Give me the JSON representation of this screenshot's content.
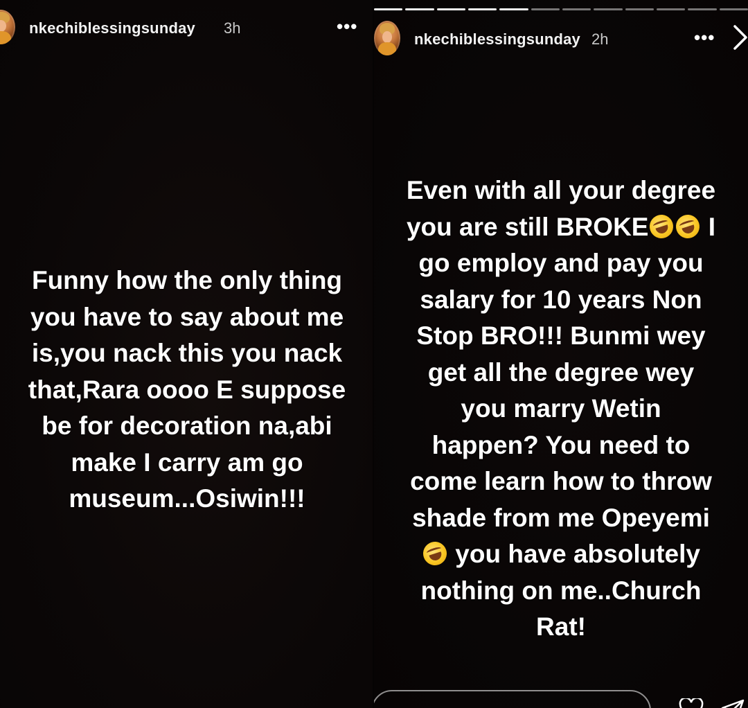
{
  "left_story": {
    "username": "nkechiblessingsunday",
    "time": "3h",
    "more_icon": "more-horizontal-icon",
    "lines": [
      "Funny how the only thing",
      "you have to say about me",
      "is,you nack this you nack",
      "that,Rara oooo E suppose",
      "be for decoration na,abi",
      "make I carry am go",
      "museum...Osiwin!!!"
    ]
  },
  "right_story": {
    "username": "nkechiblessingsunday",
    "time": "2h",
    "more_icon": "more-horizontal-icon",
    "next_icon": "chevron-right-icon",
    "progress": {
      "segments": 12,
      "completed": 5
    },
    "lines": {
      "l1": "Even with all your degree",
      "l2a": "you are still BROKE",
      "l2b": " I",
      "l3": "go employ and pay you",
      "l4": "salary for 10 years Non",
      "l5": "Stop BRO!!! Bunmi wey",
      "l6": "get all the degree wey",
      "l7": "you marry Wetin",
      "l8": "happen? You need to",
      "l9": "come learn how to throw",
      "l10": "shade from me Opeyemi",
      "l11": " you have absolutely",
      "l12": "nothing on me..Church",
      "l13": "Rat!"
    },
    "emoji": "rolling-on-floor-laughing-emoji",
    "reply_icons": [
      "heart-icon",
      "send-icon"
    ]
  },
  "colors": {
    "background": "#0a0707",
    "text": "#ffffff",
    "muted": "#c9c9c9"
  }
}
